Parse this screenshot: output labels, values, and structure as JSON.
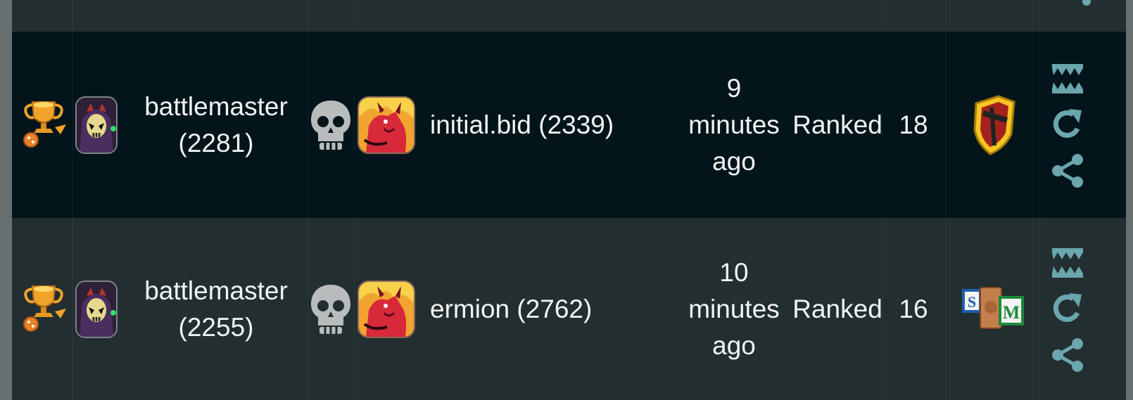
{
  "colors": {
    "row_dark": "#03151a",
    "row_light": "#232e30",
    "text": "#f2f4f4",
    "action_icon": "#6aa6ae",
    "skull": "#b8bcbd"
  },
  "rows": [
    {
      "variant": "dark",
      "trophy_icon": "gold-trophy-icon",
      "player": {
        "avatar_icon": "hooded-skull-summoner-avatar",
        "name": "battlemaster",
        "rating": "(2281)"
      },
      "result_icon": "skull-icon",
      "opponent": {
        "avatar_icon": "fire-demon-summoner-avatar",
        "name_rating": "initial.bid (2339)"
      },
      "time": [
        "9",
        "minutes",
        "ago"
      ],
      "match_type": "Ranked",
      "mana": "18",
      "ruleset_icon": "shield-ruleset-icon",
      "actions": [
        "monster-jaws-icon",
        "replay-icon",
        "share-icon"
      ]
    },
    {
      "variant": "light",
      "trophy_icon": "gold-trophy-icon",
      "player": {
        "avatar_icon": "hooded-skull-summoner-avatar",
        "name": "battlemaster",
        "rating": "(2255)"
      },
      "result_icon": "skull-icon",
      "opponent": {
        "avatar_icon": "fire-demon-summoner-avatar",
        "name_rating": "ermion (2762)"
      },
      "time": [
        "10",
        "minutes",
        "ago"
      ],
      "match_type": "Ranked",
      "mana": "16",
      "ruleset_icon": "sm-blocks-ruleset-icon",
      "actions": [
        "monster-jaws-icon",
        "replay-icon",
        "share-icon"
      ]
    }
  ]
}
